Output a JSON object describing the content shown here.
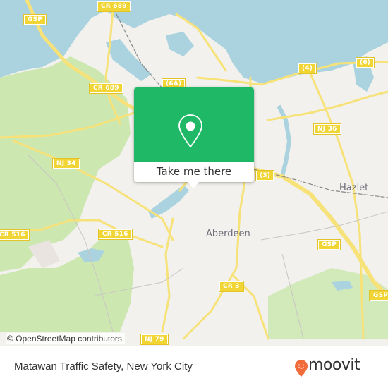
{
  "map": {
    "shields": [
      {
        "id": "gsp-nw",
        "label": "GSP"
      },
      {
        "id": "cr689-top",
        "label": "CR 689"
      },
      {
        "id": "cr689-mid",
        "label": "CR 689"
      },
      {
        "id": "rt6a",
        "label": "(6A)"
      },
      {
        "id": "rt4",
        "label": "(4)"
      },
      {
        "id": "rt6",
        "label": "(6)"
      },
      {
        "id": "nj36",
        "label": "NJ 36"
      },
      {
        "id": "nj34",
        "label": "NJ 34"
      },
      {
        "id": "rt3",
        "label": "(3)"
      },
      {
        "id": "cr516-west",
        "label": "CR 516"
      },
      {
        "id": "cr516-mid",
        "label": "CR 516"
      },
      {
        "id": "gsp-mid",
        "label": "GSP"
      },
      {
        "id": "cr3",
        "label": "CR 3"
      },
      {
        "id": "gsp-se",
        "label": "GSP"
      },
      {
        "id": "nj79",
        "label": "NJ 79"
      }
    ],
    "places": [
      {
        "id": "hazlet",
        "label": "Hazlet"
      },
      {
        "id": "aberdeen",
        "label": "Aberdeen"
      }
    ],
    "attribution": "© OpenStreetMap contributors",
    "colors": {
      "water": "#aad3df",
      "land": "#f2f1ed",
      "park": "#cde7b0",
      "road": "#f7e27a",
      "shield": "#f1d534",
      "popup": "#1fb866"
    }
  },
  "popup": {
    "icon": "location-pin-icon",
    "button_label": "Take me there"
  },
  "footer": {
    "title": "Matawan Traffic Safety, New York City",
    "brand": "moovit",
    "brand_color": "#f26b3a"
  }
}
